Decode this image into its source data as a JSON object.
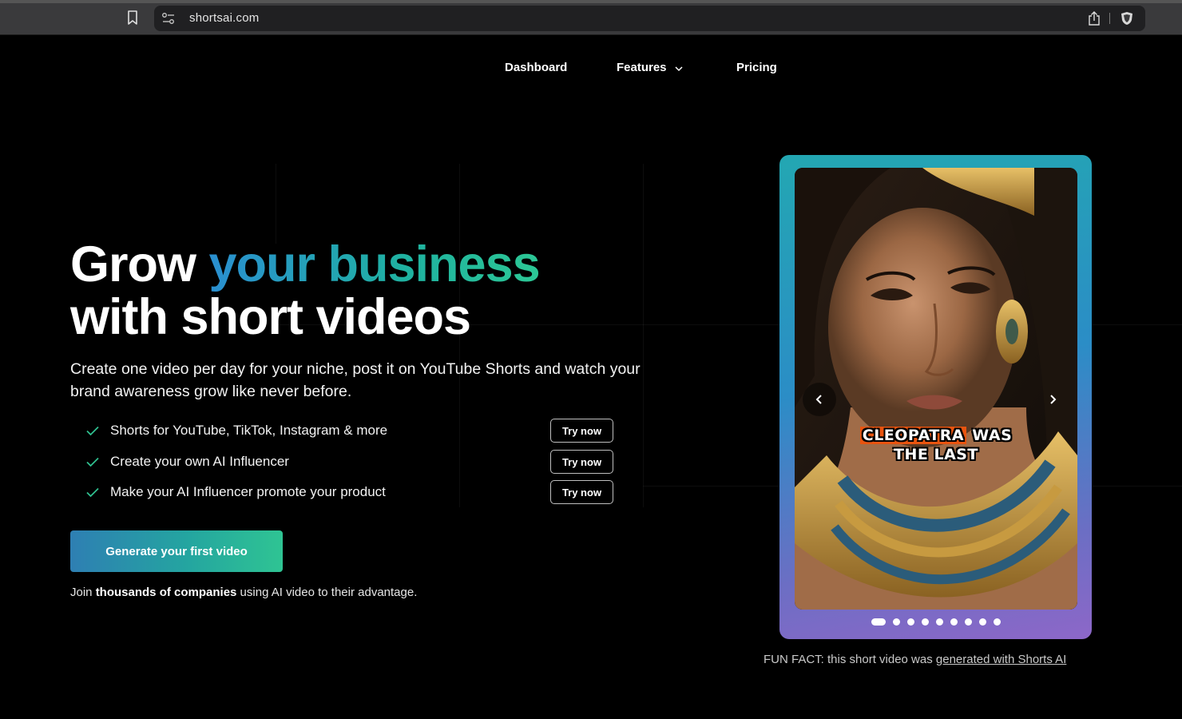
{
  "browser": {
    "url": "shortsai.com"
  },
  "nav": {
    "dashboard": "Dashboard",
    "features": "Features",
    "pricing": "Pricing"
  },
  "hero": {
    "title_prefix": "Grow ",
    "title_accent": "your business",
    "title_line2": "with short videos",
    "subtitle": "Create one video per day for your niche, post it on YouTube Shorts and watch your brand awareness grow like never before.",
    "features": [
      {
        "label": "Shorts for YouTube, TikTok, Instagram & more",
        "button": "Try now"
      },
      {
        "label": "Create your own AI Influencer",
        "button": "Try now"
      },
      {
        "label": "Make your AI Influencer promote your product",
        "button": "Try now"
      }
    ],
    "cta": "Generate your first video",
    "social_proof_prefix": "Join ",
    "social_proof_bold": "thousands of companies",
    "social_proof_suffix": " using AI video to their advantage."
  },
  "video": {
    "caption_highlight": "CLEOPATRA",
    "caption_rest_line1": " WAS",
    "caption_line2": "THE LAST",
    "slide_count": 9,
    "active_slide": 1
  },
  "fun_fact": {
    "prefix": "FUN FACT: this short video was ",
    "link": "generated with Shorts AI"
  },
  "colors": {
    "accent_blue": "#2a8fd0",
    "accent_green": "#2cc795",
    "caption_highlight": "#e8540f"
  }
}
